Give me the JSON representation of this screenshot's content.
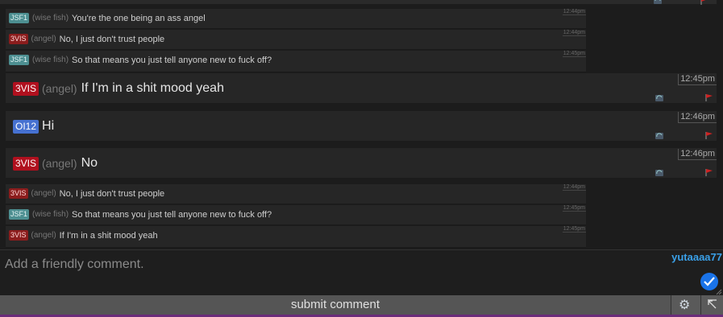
{
  "messages_top": [
    {
      "badge": "JSF1",
      "badge_color": "#4d8f91",
      "nick": "(wise fish)",
      "text": "You're the one being an ass angel",
      "time": "12:44pm"
    },
    {
      "badge": "3VIS",
      "badge_color": "#8b1d1d",
      "nick": "(angel)",
      "text": "No, I just don't trust people",
      "time": "12:44pm"
    },
    {
      "badge": "JSF1",
      "badge_color": "#4d8f91",
      "nick": "(wise fish)",
      "text": "So that means you just tell anyone new to fuck off?",
      "time": "12:45pm"
    }
  ],
  "messages_big": [
    {
      "badge": "3VIS",
      "badge_color": "#b0101e",
      "nick": "(angel)",
      "text": "If I'm in a shit mood yeah",
      "time": "12:45pm"
    },
    {
      "badge": "OI12",
      "badge_color": "#4671d1",
      "nick": "",
      "text": "Hi",
      "time": "12:46pm"
    },
    {
      "badge": "3VIS",
      "badge_color": "#b0101e",
      "nick": "(angel)",
      "text": "No",
      "time": "12:46pm"
    }
  ],
  "messages_bottom": [
    {
      "badge": "3VIS",
      "badge_color": "#8b1d1d",
      "nick": "(angel)",
      "text": "No, I just don't trust people",
      "time": "12:44pm"
    },
    {
      "badge": "JSF1",
      "badge_color": "#4d8f91",
      "nick": "(wise fish)",
      "text": "So that means you just tell anyone new to fuck off?",
      "time": "12:45pm"
    },
    {
      "badge": "3VIS",
      "badge_color": "#8b1d1d",
      "nick": "(angel)",
      "text": "If I'm in a shit mood yeah",
      "time": "12:45pm"
    }
  ],
  "more_indicator": "•••",
  "comment_input": {
    "placeholder": "Add a friendly comment.",
    "value": ""
  },
  "username": "yutaaaa77",
  "submit_label": "submit comment",
  "icons": {
    "settings": "gear-icon",
    "expand": "expand-icon",
    "refresh": "refresh-icon",
    "flag": "flag-icon",
    "check": "check-icon"
  },
  "colors": {
    "accent": "#1a73e8",
    "username": "#3aa0e8",
    "flag": "#cc2222"
  }
}
